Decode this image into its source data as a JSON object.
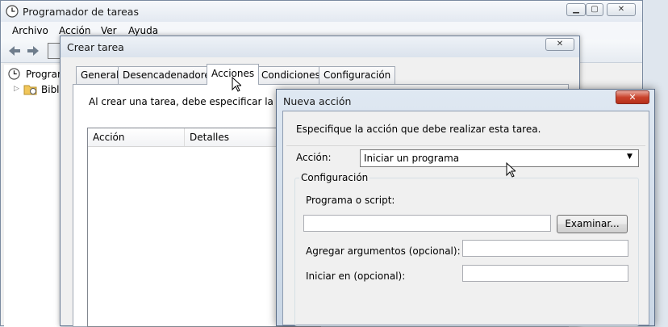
{
  "main_window": {
    "title": "Programador de tareas",
    "menu": [
      "Archivo",
      "Acción",
      "Ver",
      "Ayuda"
    ],
    "tree": {
      "item1": "Program",
      "item2": "Bibli"
    }
  },
  "crear_tarea": {
    "title": "Crear tarea",
    "tabs": [
      "General",
      "Desencadenadores",
      "Acciones",
      "Condiciones",
      "Configuración"
    ],
    "active_tab": "Acciones",
    "description": "Al crear una tarea, debe especificar la acción",
    "columns": [
      "Acción",
      "Detalles"
    ]
  },
  "nueva_accion": {
    "title": "Nueva acción",
    "instruction": "Especifique la acción que debe realizar esta tarea.",
    "action_label": "Acción:",
    "action_value": "Iniciar un programa",
    "group_label": "Configuración",
    "program_label": "Programa o script:",
    "program_value": "",
    "browse_label": "Examinar...",
    "args_label": "Agregar argumentos (opcional):",
    "args_value": "",
    "start_in_label": "Iniciar en (opcional):",
    "start_in_value": ""
  }
}
